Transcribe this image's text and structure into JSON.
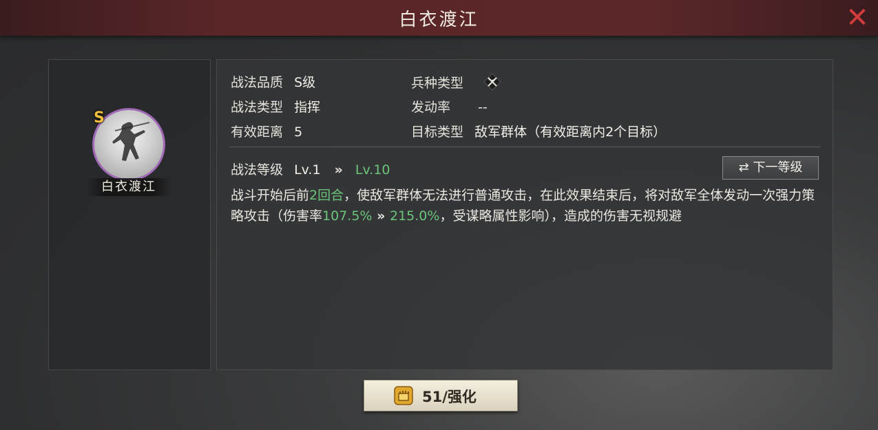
{
  "window": {
    "title": "白衣渡江"
  },
  "close_icon": "close-icon",
  "skill": {
    "grade_badge": "S",
    "name": "白衣渡江"
  },
  "info": {
    "quality_label": "战法品质",
    "quality_value": "S级",
    "troop_label": "兵种类型",
    "troop_icon": "crossed-bows-icon",
    "type_label": "战法类型",
    "type_value": "指挥",
    "rate_label": "发动率",
    "rate_value": "--",
    "range_label": "有效距离",
    "range_value": "5",
    "target_label": "目标类型",
    "target_value": "敌军群体（有效距离内2个目标）"
  },
  "level": {
    "label": "战法等级",
    "current": "Lv.1",
    "arrow": "»",
    "next": "Lv.10",
    "next_button_label": "⇄ 下一等级"
  },
  "description": {
    "p1": "战斗开始后前",
    "p2": "2回合",
    "p3": "，使敌军群体无法进行普通攻击，在此效果结束后，将对敌军全体发动一次强力策略攻击（伤害率",
    "p4": "107.5%",
    "p5": " » ",
    "p6": "215.0%",
    "p7": "，受谋略属性影响），造成的伤害无视规避"
  },
  "enhance": {
    "label": "51/强化"
  },
  "colors": {
    "accent_green": "#6cc47a",
    "close_red": "#d23c3c",
    "grade_gold": "#f2c03c",
    "portrait_ring": "#a06ab6"
  }
}
